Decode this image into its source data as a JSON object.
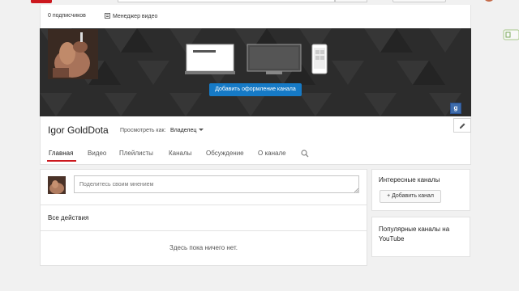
{
  "header": {
    "subscribers": "0 подписчиков",
    "video_manager": "Менеджер видео"
  },
  "banner": {
    "add_art_label": "Добавить оформление канала",
    "gplus_label": "g"
  },
  "channel": {
    "name": "Igor GoldDota",
    "view_as_label": "Просмотреть как:",
    "view_as_value": "Владелец"
  },
  "tabs": [
    {
      "label": "Главная",
      "active": true
    },
    {
      "label": "Видео"
    },
    {
      "label": "Плейлисты"
    },
    {
      "label": "Каналы"
    },
    {
      "label": "Обсуждение"
    },
    {
      "label": "О канале"
    }
  ],
  "feed": {
    "input_placeholder": "Поделитесь своим мнением",
    "all_actions_title": "Все действия",
    "empty_message": "Здесь пока ничего нет."
  },
  "sidebar": {
    "featured_title": "Интересные каналы",
    "add_channel_label": "+ Добавить канал",
    "popular_title": "Популярные каналы на YouTube"
  },
  "colors": {
    "accent_red": "#cc181e",
    "button_blue": "#167ac6",
    "gplus_blue": "#3e6cab",
    "page_bg": "#f1f1f1"
  },
  "icons": {
    "video_manager": "film-icon",
    "edit": "pencil-icon",
    "search": "magnifier-icon",
    "gplus": "google-plus-icon"
  }
}
